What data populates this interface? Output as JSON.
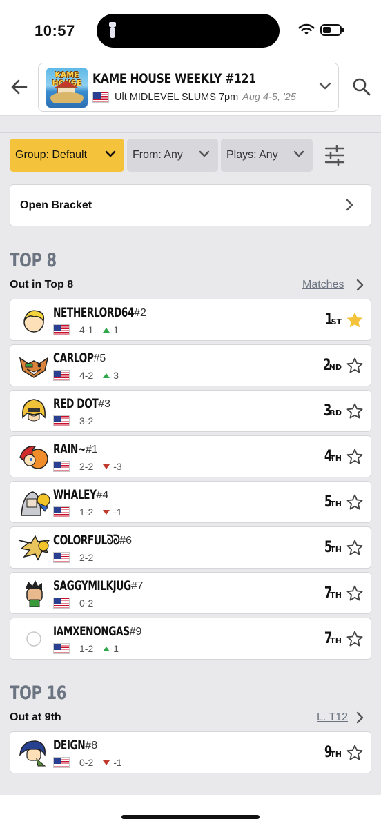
{
  "status_bar": {
    "time": "10:57"
  },
  "header": {
    "event_thumb_text": "KAME HOUSE",
    "event_title": "KAME HOUSE WEEKLY #121",
    "event_subtitle": "Ult MIDLEVEL SLUMS 7pm",
    "event_dates": "Aug 4-5, '25"
  },
  "filters": {
    "group": "Group: Default",
    "from": "From: Any",
    "plays": "Plays: Any"
  },
  "open_bracket": {
    "label": "Open Bracket"
  },
  "top8": {
    "title": "TOP 8",
    "subtitle": "Out in Top 8",
    "link": "Matches",
    "players": [
      {
        "name": "NETHERLORD64",
        "seed": "#2",
        "record": "4-1",
        "change": "1",
        "dir": "up",
        "place": "1",
        "suffix": "ST",
        "starred": true,
        "avatar": "lucas"
      },
      {
        "name": "CARLOP",
        "seed": "#5",
        "record": "4-2",
        "change": "3",
        "dir": "up",
        "place": "2",
        "suffix": "ND",
        "starred": false,
        "avatar": "fox"
      },
      {
        "name": "RED DOT",
        "seed": "#3",
        "record": "3-2",
        "change": "",
        "dir": "",
        "place": "3",
        "suffix": "RD",
        "starred": false,
        "avatar": "ken"
      },
      {
        "name": "RAIN~",
        "seed": "#1",
        "record": "2-2",
        "change": "-3",
        "dir": "down",
        "place": "4",
        "suffix": "TH",
        "starred": false,
        "avatar": "roy"
      },
      {
        "name": "WHALEY",
        "seed": "#4",
        "record": "1-2",
        "change": "-1",
        "dir": "down",
        "place": "5",
        "suffix": "TH",
        "starred": false,
        "avatar": "sephiroth"
      },
      {
        "name": "COLORFULᘐᘐ",
        "seed": "#6",
        "record": "2-2",
        "change": "",
        "dir": "",
        "place": "5",
        "suffix": "TH",
        "starred": false,
        "avatar": "cloud"
      },
      {
        "name": "SAGGYMILKJUG",
        "seed": "#7",
        "record": "0-2",
        "change": "",
        "dir": "",
        "place": "7",
        "suffix": "TH",
        "starred": false,
        "avatar": "kazuya"
      },
      {
        "name": "IAMXENONGAS",
        "seed": "#9",
        "record": "1-2",
        "change": "1",
        "dir": "up",
        "place": "7",
        "suffix": "TH",
        "starred": false,
        "avatar": "none"
      }
    ]
  },
  "top16": {
    "title": "TOP 16",
    "subtitle": "Out at 9th",
    "link": "L. T12",
    "players": [
      {
        "name": "DEIGN",
        "seed": "#8",
        "record": "0-2",
        "change": "-1",
        "dir": "down",
        "place": "9",
        "suffix": "TH",
        "starred": false,
        "avatar": "marth"
      }
    ]
  },
  "colors": {
    "accent": "#f5c33b",
    "muted": "#6b7480",
    "up": "#2ea84a",
    "down": "#c0392b",
    "star_filled": "#f5c33b"
  }
}
